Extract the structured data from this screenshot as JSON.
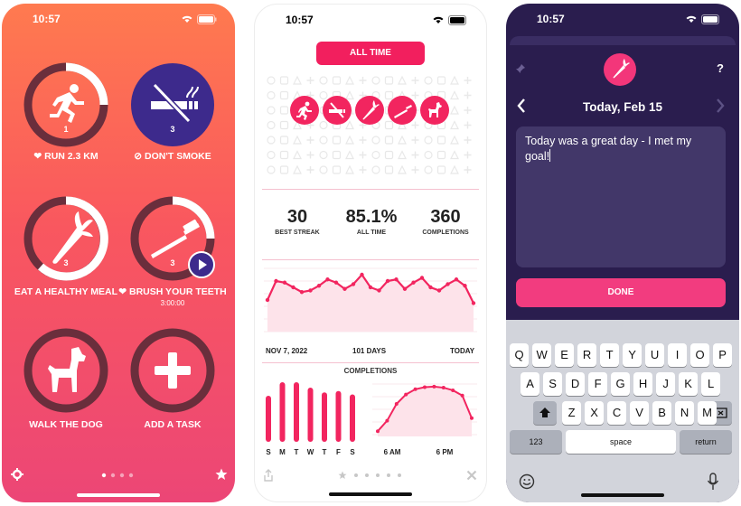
{
  "colors": {
    "accent": "#f2255f",
    "purple": "#3d2a8c",
    "dark_bg": "#2a1d4e"
  },
  "phone1": {
    "time": "10:57",
    "habits": [
      {
        "label": "RUN 2.3 KM",
        "prefix": "❤",
        "count": "1",
        "icon": "running-icon"
      },
      {
        "label": "DON'T SMOKE",
        "prefix": "⊘",
        "count": "3",
        "icon": "no-smoking-icon"
      },
      {
        "label": "EAT A HEALTHY MEAL",
        "prefix": "",
        "count": "3",
        "icon": "carrot-icon"
      },
      {
        "label": "BRUSH YOUR TEETH",
        "prefix": "❤",
        "count": "3",
        "icon": "toothbrush-icon",
        "sub": "3:00:00"
      },
      {
        "label": "WALK THE DOG",
        "prefix": "",
        "count": "",
        "icon": "dog-icon"
      },
      {
        "label": "ADD A TASK",
        "prefix": "",
        "count": "",
        "icon": "plus-icon"
      }
    ]
  },
  "phone2": {
    "time": "10:57",
    "period": "ALL TIME",
    "stats": [
      {
        "value": "30",
        "label": "BEST STREAK"
      },
      {
        "value": "85.1%",
        "label": "ALL TIME"
      },
      {
        "value": "360",
        "label": "COMPLETIONS"
      }
    ],
    "range": {
      "start": "NOV 7, 2022",
      "mid": "101 DAYS",
      "end": "TODAY"
    },
    "completions_title": "COMPLETIONS",
    "weekdays": [
      "S",
      "M",
      "T",
      "W",
      "T",
      "F",
      "S"
    ],
    "hours": [
      "6 AM",
      "6 PM"
    ],
    "chart_data": [
      {
        "type": "area",
        "x": [
          0,
          1,
          2,
          3,
          4,
          5,
          6,
          7,
          8,
          9,
          10,
          11,
          12,
          13,
          14,
          15,
          16,
          17,
          18,
          19,
          20,
          21,
          22,
          23,
          24
        ],
        "values": [
          20,
          32,
          31,
          28,
          25,
          26,
          29,
          33,
          31,
          27,
          30,
          36,
          28,
          26,
          32,
          33,
          27,
          31,
          34,
          28,
          26,
          30,
          33,
          29,
          18
        ]
      },
      {
        "type": "bar",
        "categories": [
          "S",
          "M",
          "T",
          "W",
          "T",
          "F",
          "S"
        ],
        "values": [
          68,
          88,
          88,
          80,
          73,
          75,
          70
        ]
      },
      {
        "type": "area",
        "values": [
          10,
          30,
          62,
          80,
          90,
          94,
          95,
          93,
          88,
          78,
          35
        ]
      }
    ]
  },
  "phone3": {
    "time": "10:57",
    "date": "Today, Feb 15",
    "help": "?",
    "note": "Today was a great day - I met my goal!",
    "done": "DONE",
    "keyboard": {
      "row1": [
        "Q",
        "W",
        "E",
        "R",
        "T",
        "Y",
        "U",
        "I",
        "O",
        "P"
      ],
      "row2": [
        "A",
        "S",
        "D",
        "F",
        "G",
        "H",
        "J",
        "K",
        "L"
      ],
      "row3": [
        "Z",
        "X",
        "C",
        "V",
        "B",
        "N",
        "M"
      ],
      "numbers": "123",
      "space": "space",
      "return": "return"
    }
  }
}
